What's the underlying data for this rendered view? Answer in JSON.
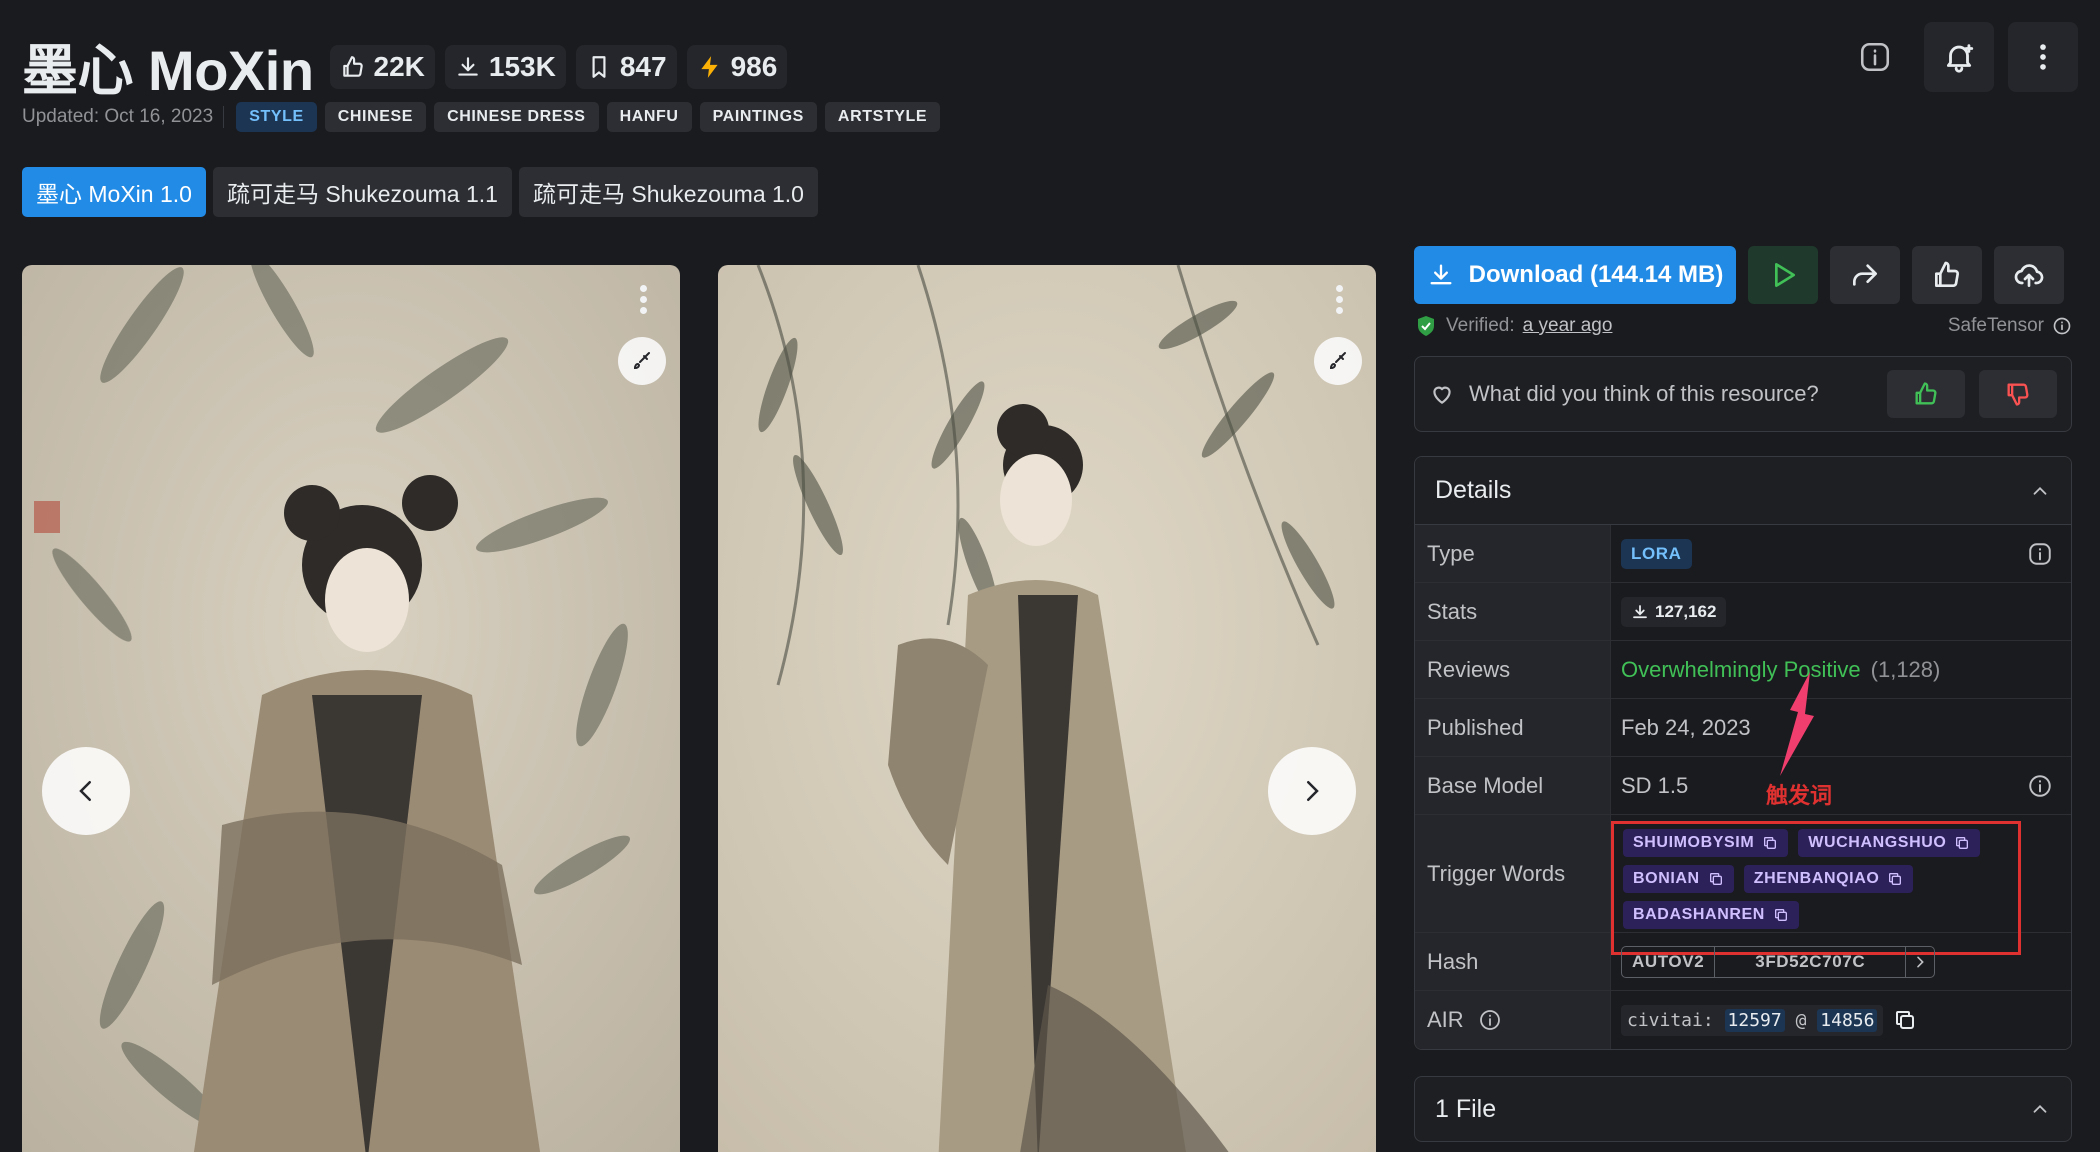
{
  "header": {
    "title": "墨心 MoXin",
    "stats": {
      "likes": "22K",
      "downloads": "153K",
      "bookmarks": "847",
      "buzz": "986"
    },
    "updated": "Updated: Oct 16, 2023",
    "tags": [
      "STYLE",
      "CHINESE",
      "CHINESE DRESS",
      "HANFU",
      "PAINTINGS",
      "ARTSTYLE"
    ]
  },
  "versions": [
    "墨心 MoXin 1.0",
    "疏可走马 Shukezouma 1.1",
    "疏可走马 Shukezouma 1.0"
  ],
  "sidebar": {
    "download_label": "Download (144.14 MB)",
    "verified_label": "Verified:",
    "verified_time": "a year ago",
    "format": "SafeTensor",
    "feedback_prompt": "What did you think of this resource?",
    "details_title": "Details",
    "details": {
      "type_label": "Type",
      "type_value": "LORA",
      "stats_label": "Stats",
      "stats_value": "127,162",
      "reviews_label": "Reviews",
      "reviews_value": "Overwhelmingly Positive",
      "reviews_count": "(1,128)",
      "published_label": "Published",
      "published_value": "Feb 24, 2023",
      "base_label": "Base Model",
      "base_value": "SD 1.5",
      "trigger_label": "Trigger Words",
      "trigger_words": [
        "SHUIMOBYSIM",
        "WUCHANGSHUO",
        "BONIAN",
        "ZHENBANQIAO",
        "BADASHANREN"
      ],
      "hash_label": "Hash",
      "hash_algo": "AUTOV2",
      "hash_value": "3FD52C707C",
      "air_label": "AIR",
      "air_prefix": "civitai:",
      "air_model": "12597",
      "air_at": "@",
      "air_version": "14856"
    },
    "annotation": "触发词",
    "files_title": "1 File"
  },
  "colors": {
    "accent": "#228be6",
    "positive": "#40c057",
    "annotation": "#e03131"
  }
}
